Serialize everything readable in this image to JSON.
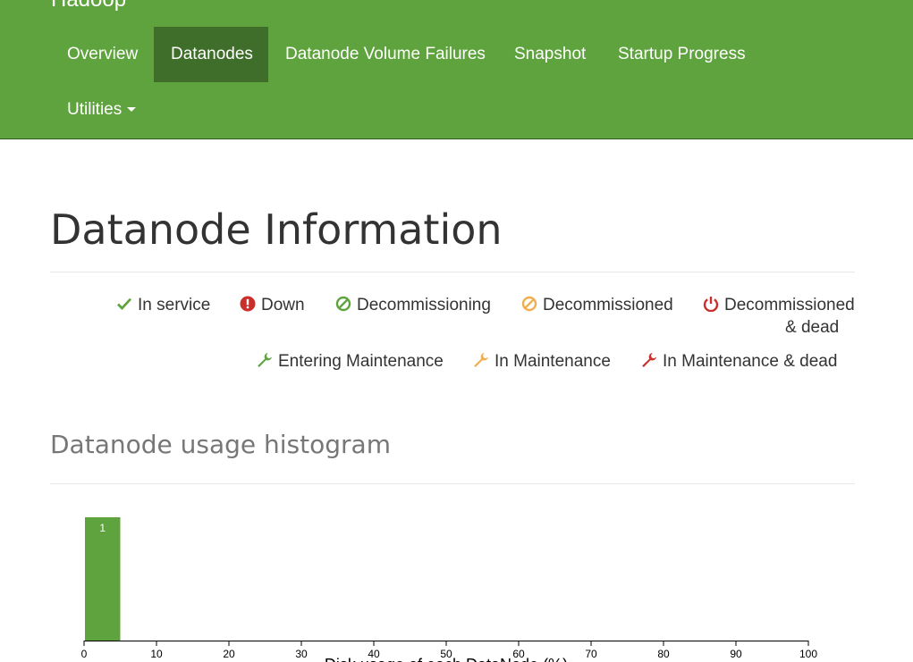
{
  "navbar": {
    "brand": "Hadoop",
    "items": [
      {
        "label": "Overview",
        "active": false
      },
      {
        "label": "Datanodes",
        "active": true
      },
      {
        "label": "Datanode Volume Failures",
        "active": false
      },
      {
        "label": "Snapshot",
        "active": false
      },
      {
        "label": "Startup Progress",
        "active": false
      },
      {
        "label": "Utilities",
        "active": false,
        "dropdown": true
      }
    ]
  },
  "page": {
    "title": "Datanode Information"
  },
  "legend": [
    {
      "label": "In service",
      "icon": "check-icon",
      "color": "#5fa33e"
    },
    {
      "label": "Down",
      "icon": "exclamation-circle-icon",
      "color": "#c9302c"
    },
    {
      "label": "Decommissioning",
      "icon": "ban-icon",
      "color": "#5fa33e"
    },
    {
      "label": "Decommissioned",
      "icon": "ban-icon",
      "color": "#f0ad4e"
    },
    {
      "label": "Decommissioned",
      "label_line2": "& dead",
      "icon": "power-off-icon",
      "color": "#c9302c"
    },
    {
      "label": "Entering Maintenance",
      "icon": "wrench-icon",
      "color": "#5fa33e"
    },
    {
      "label": "In Maintenance",
      "icon": "wrench-icon",
      "color": "#f0ad4e"
    },
    {
      "label": "In Maintenance & dead",
      "icon": "wrench-icon",
      "color": "#c9302c"
    }
  ],
  "histogram": {
    "title": "Datanode usage histogram"
  },
  "chart_data": {
    "type": "bar",
    "title": "Datanode usage histogram",
    "xlabel": "Disk usage of each DataNode (%)",
    "ylabel": "",
    "xlim": [
      0,
      100
    ],
    "x_ticks": [
      0,
      10,
      20,
      30,
      40,
      50,
      60,
      70,
      80,
      90,
      100
    ],
    "bins": [
      {
        "x0": 0,
        "x1": 5,
        "count": 1
      }
    ],
    "bar_color": "#5fa33e",
    "grid": false
  }
}
